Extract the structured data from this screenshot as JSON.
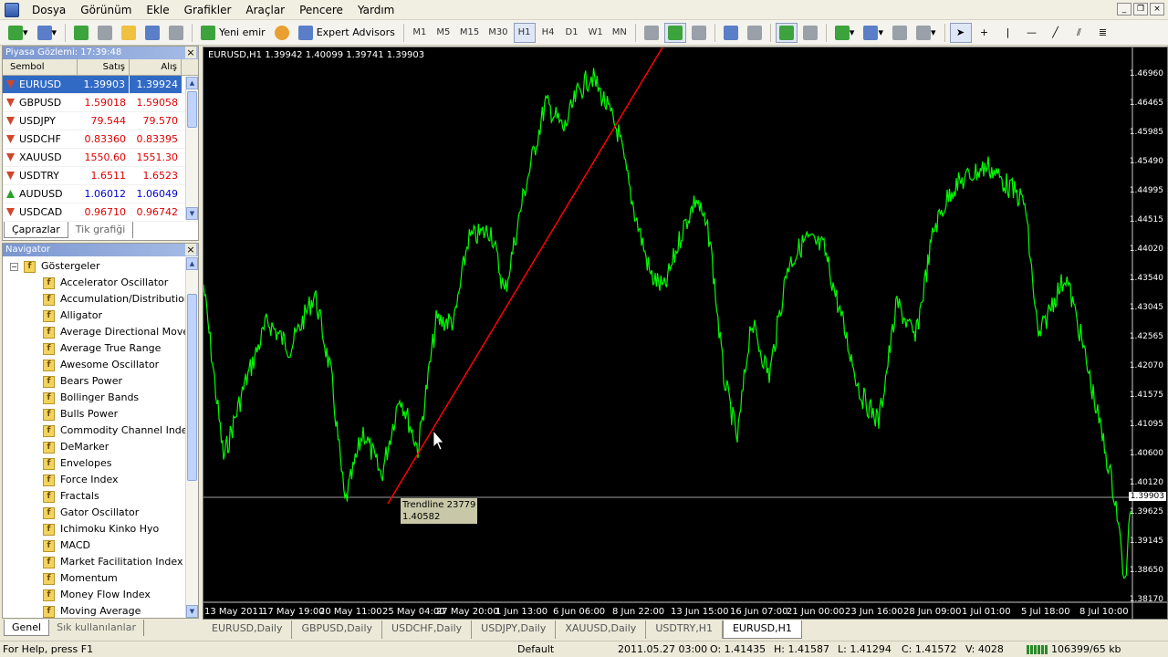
{
  "menu": [
    "Dosya",
    "Görünüm",
    "Ekle",
    "Grafikler",
    "Araçlar",
    "Pencere",
    "Yardım"
  ],
  "toolbar": {
    "new_order": "Yeni emir",
    "expert_advisors": "Expert Advisors",
    "timeframes": [
      "M1",
      "M5",
      "M15",
      "M30",
      "H1",
      "H4",
      "D1",
      "W1",
      "MN"
    ],
    "active_timeframe": "H1"
  },
  "market_watch": {
    "title": "Piyasa Gözlemi: 17:39:48",
    "headers": {
      "symbol": "Sembol",
      "bid": "Satış",
      "ask": "Alış"
    },
    "rows": [
      {
        "symbol": "EURUSD",
        "bid": "1.39903",
        "ask": "1.39924",
        "dir": "down",
        "color": "white",
        "selected": true
      },
      {
        "symbol": "GBPUSD",
        "bid": "1.59018",
        "ask": "1.59058",
        "dir": "down",
        "color": "red"
      },
      {
        "symbol": "USDJPY",
        "bid": "79.544",
        "ask": "79.570",
        "dir": "down",
        "color": "red"
      },
      {
        "symbol": "USDCHF",
        "bid": "0.83360",
        "ask": "0.83395",
        "dir": "down",
        "color": "red"
      },
      {
        "symbol": "XAUUSD",
        "bid": "1550.60",
        "ask": "1551.30",
        "dir": "down",
        "color": "red"
      },
      {
        "symbol": "USDTRY",
        "bid": "1.6511",
        "ask": "1.6523",
        "dir": "down",
        "color": "red"
      },
      {
        "symbol": "AUDUSD",
        "bid": "1.06012",
        "ask": "1.06049",
        "dir": "up",
        "color": "blue"
      },
      {
        "symbol": "USDCAD",
        "bid": "0.96710",
        "ask": "0.96742",
        "dir": "down",
        "color": "red"
      }
    ],
    "tabs": [
      "Çaprazlar",
      "Tik grafiği"
    ]
  },
  "navigator": {
    "title": "Navigator",
    "root": "Göstergeler",
    "items": [
      "Accelerator Oscillator",
      "Accumulation/Distribution",
      "Alligator",
      "Average Directional Movement",
      "Average True Range",
      "Awesome Oscillator",
      "Bears Power",
      "Bollinger Bands",
      "Bulls Power",
      "Commodity Channel Index",
      "DeMarker",
      "Envelopes",
      "Force Index",
      "Fractals",
      "Gator Oscillator",
      "Ichimoku Kinko Hyo",
      "MACD",
      "Market Facilitation Index",
      "Momentum",
      "Money Flow Index",
      "Moving Average"
    ],
    "tabs": [
      "Genel",
      "Sık kullanılanlar"
    ]
  },
  "chart": {
    "info": "EURUSD,H1  1.39942 1.40099 1.39741 1.39903",
    "trendline_name": "Trendline 23779",
    "trendline_price": "1.40582",
    "current_price": "1.39903",
    "price_labels": [
      "1.46960",
      "1.46465",
      "1.45985",
      "1.45490",
      "1.44995",
      "1.44515",
      "1.44020",
      "1.43540",
      "1.43045",
      "1.42565",
      "1.42070",
      "1.41575",
      "1.41095",
      "1.40600",
      "1.40120",
      "1.39625",
      "1.39145",
      "1.38650",
      "1.38170"
    ],
    "time_labels": [
      "13 May 2011",
      "17 May 19:00",
      "20 May 11:00",
      "25 May 04:00",
      "27 May 20:00",
      "1 Jun 13:00",
      "6 Jun 06:00",
      "8 Jun 22:00",
      "13 Jun 15:00",
      "16 Jun 07:00",
      "21 Jun 00:00",
      "23 Jun 16:00",
      "28 Jun 09:00",
      "1 Jul 01:00",
      "5 Jul 18:00",
      "8 Jul 10:00"
    ],
    "colors": {
      "price_line": "#00ff00",
      "trendline": "#ff0000",
      "background": "#000000"
    }
  },
  "chart_tabs": [
    "EURUSD,Daily",
    "GBPUSD,Daily",
    "USDCHF,Daily",
    "USDJPY,Daily",
    "XAUUSD,Daily",
    "USDTRY,H1",
    "EURUSD,H1"
  ],
  "active_chart_tab": "EURUSD,H1",
  "status": {
    "help": "For Help, press F1",
    "profile": "Default",
    "datetime": "2011.05.27 03:00",
    "open": "O: 1.41435",
    "high": "H: 1.41587",
    "low": "L: 1.41294",
    "close": "C: 1.41572",
    "volume": "V: 4028",
    "traffic": "106399/65 kb"
  }
}
